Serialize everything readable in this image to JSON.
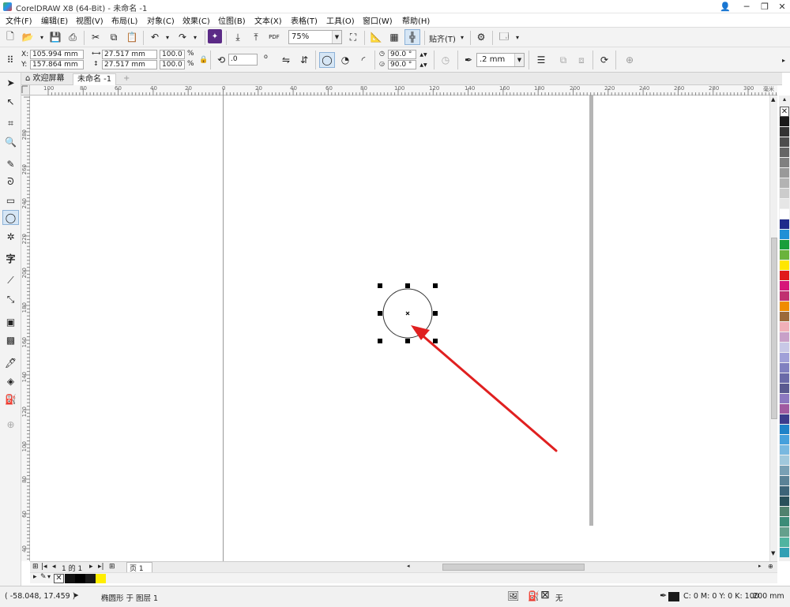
{
  "window": {
    "title": "CorelDRAW X8 (64-Bit) - 未命名 -1"
  },
  "menu": [
    "文件(F)",
    "编辑(E)",
    "视图(V)",
    "布局(L)",
    "对象(C)",
    "效果(C)",
    "位图(B)",
    "文本(X)",
    "表格(T)",
    "工具(O)",
    "窗口(W)",
    "帮助(H)"
  ],
  "toolbar": {
    "zoom_value": "75%",
    "snap_label": "贴齐(T)",
    "pdf_label": "PDF"
  },
  "property_bar": {
    "x_label": "X:",
    "x_value": "105.994 mm",
    "y_label": "Y:",
    "y_value": "157.864 mm",
    "width_value": "27.517 mm",
    "height_value": "27.517 mm",
    "scale_x": "100.0",
    "scale_y": "100.0",
    "percent": "%",
    "rotation_value": ".0",
    "degree": "o",
    "start_angle": "90.0 °",
    "end_angle": "90.0 °",
    "outline_width": ".2 mm"
  },
  "tabs": [
    {
      "label": "欢迎屏幕",
      "active": false
    },
    {
      "label": "未命名 -1",
      "active": true
    }
  ],
  "rulers": {
    "h_ticks": [
      "100",
      "80",
      "60",
      "40",
      "20",
      "0",
      "20",
      "40",
      "60",
      "80",
      "100",
      "120",
      "140",
      "160",
      "180",
      "200",
      "220",
      "240",
      "260",
      "280",
      "300"
    ],
    "h_unit": "毫米",
    "v_ticks": [
      "280",
      "260",
      "240",
      "220",
      "200",
      "180",
      "160",
      "140",
      "120",
      "100",
      "80",
      "60",
      "40",
      "20"
    ]
  },
  "page_nav": {
    "page_count_text": "1 的 1",
    "page_tab": "页 1"
  },
  "status": {
    "cursor_coords": "( -58.048, 17.459 )",
    "selection_info": "椭圆形 于 图层 1",
    "fill_none": "无",
    "outline_color": "C: 0 M: 0 Y: 0 K: 100",
    "outline_width": ".200 mm"
  },
  "colors": {
    "accent_red": "#e02020",
    "palette": [
      "#ffffff",
      "#1a1a1a",
      "#333333",
      "#4d4d4d",
      "#666666",
      "#808080",
      "#999999",
      "#b3b3b3",
      "#cccccc",
      "#e6e6e6",
      "#ffffff",
      "#1f2a8c",
      "#1e90d6",
      "#1a9e3a",
      "#6bb33c",
      "#ffe600",
      "#e01a1a",
      "#d6157a",
      "#c03070",
      "#f08c00",
      "#9b6a3a",
      "#f0b0b8",
      "#c8a0c8",
      "#c8c8e6",
      "#a0a0d8",
      "#8080c0",
      "#6a6aa8",
      "#5a5a90",
      "#8c78c0",
      "#a05aa0",
      "#3c3c8c",
      "#1e82c8",
      "#46a0dc",
      "#78b8e0",
      "#a0c8dc",
      "#78a0b4",
      "#5a8296",
      "#3c6478",
      "#28505a",
      "#50826e",
      "#3c8c78",
      "#64a08c",
      "#50b4a0",
      "#32a0b4"
    ],
    "doc_palette": [
      "#111111",
      "#000000",
      "#1a1a1a",
      "#ffee00"
    ]
  }
}
